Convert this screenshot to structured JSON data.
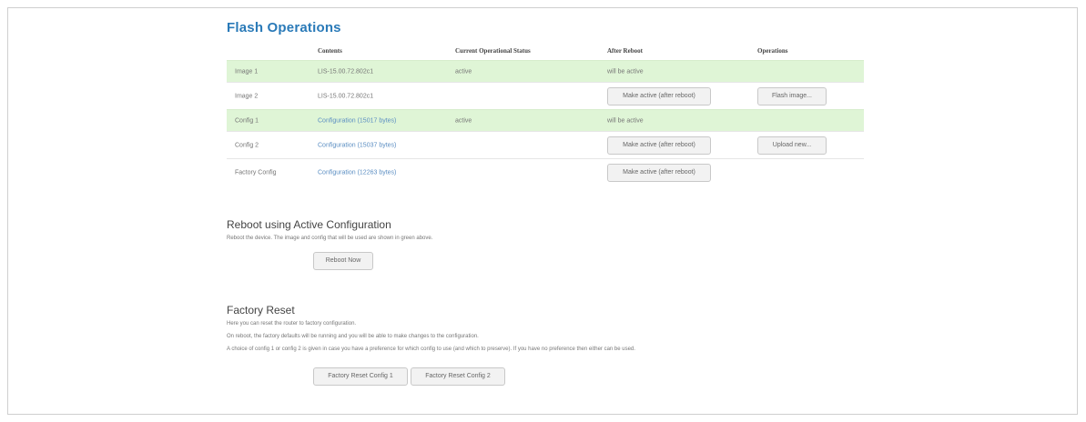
{
  "page": {
    "title": "Flash Operations"
  },
  "table": {
    "headers": {
      "contents": "Contents",
      "status": "Current Operational Status",
      "after_reboot": "After Reboot",
      "operations": "Operations"
    },
    "rows": [
      {
        "name": "Image 1",
        "contents": "LIS-15.00.72.802c1",
        "status": "active",
        "after_reboot": "will be active",
        "reboot_button": "",
        "operation_button": ""
      },
      {
        "name": "Image 2",
        "contents": "LIS-15.00.72.802c1",
        "status": "",
        "after_reboot": "",
        "reboot_button": "Make active (after reboot)",
        "operation_button": "Flash image..."
      },
      {
        "name": "Config 1",
        "contents": "Configuration (15017 bytes)",
        "status": "active",
        "after_reboot": "will be active",
        "reboot_button": "",
        "operation_button": ""
      },
      {
        "name": "Config 2",
        "contents": "Configuration (15037 bytes)",
        "status": "",
        "after_reboot": "",
        "reboot_button": "Make active (after reboot)",
        "operation_button": "Upload new..."
      },
      {
        "name": "Factory Config",
        "contents": "Configuration (12263 bytes)",
        "status": "",
        "after_reboot": "",
        "reboot_button": "Make active (after reboot)",
        "operation_button": ""
      }
    ]
  },
  "reboot": {
    "title": "Reboot using Active Configuration",
    "description": "Reboot the device. The image and config that will be used are shown in green above.",
    "button": "Reboot Now"
  },
  "factory_reset": {
    "title": "Factory Reset",
    "line1": "Here you can reset the router to factory configuration.",
    "line2": "On reboot, the factory defaults will be running and you will be able to make changes to the configuration.",
    "line3": "A choice of config 1 or config 2 is given in case you have a preference for which config to use (and which to preserve). If you have no preference then either can be used.",
    "button1": "Factory Reset Config 1",
    "button2": "Factory Reset Config 2"
  },
  "colors": {
    "title_blue": "#2a7ab8",
    "link_blue": "#5b8ec2",
    "active_row_green": "#dff5d6"
  }
}
